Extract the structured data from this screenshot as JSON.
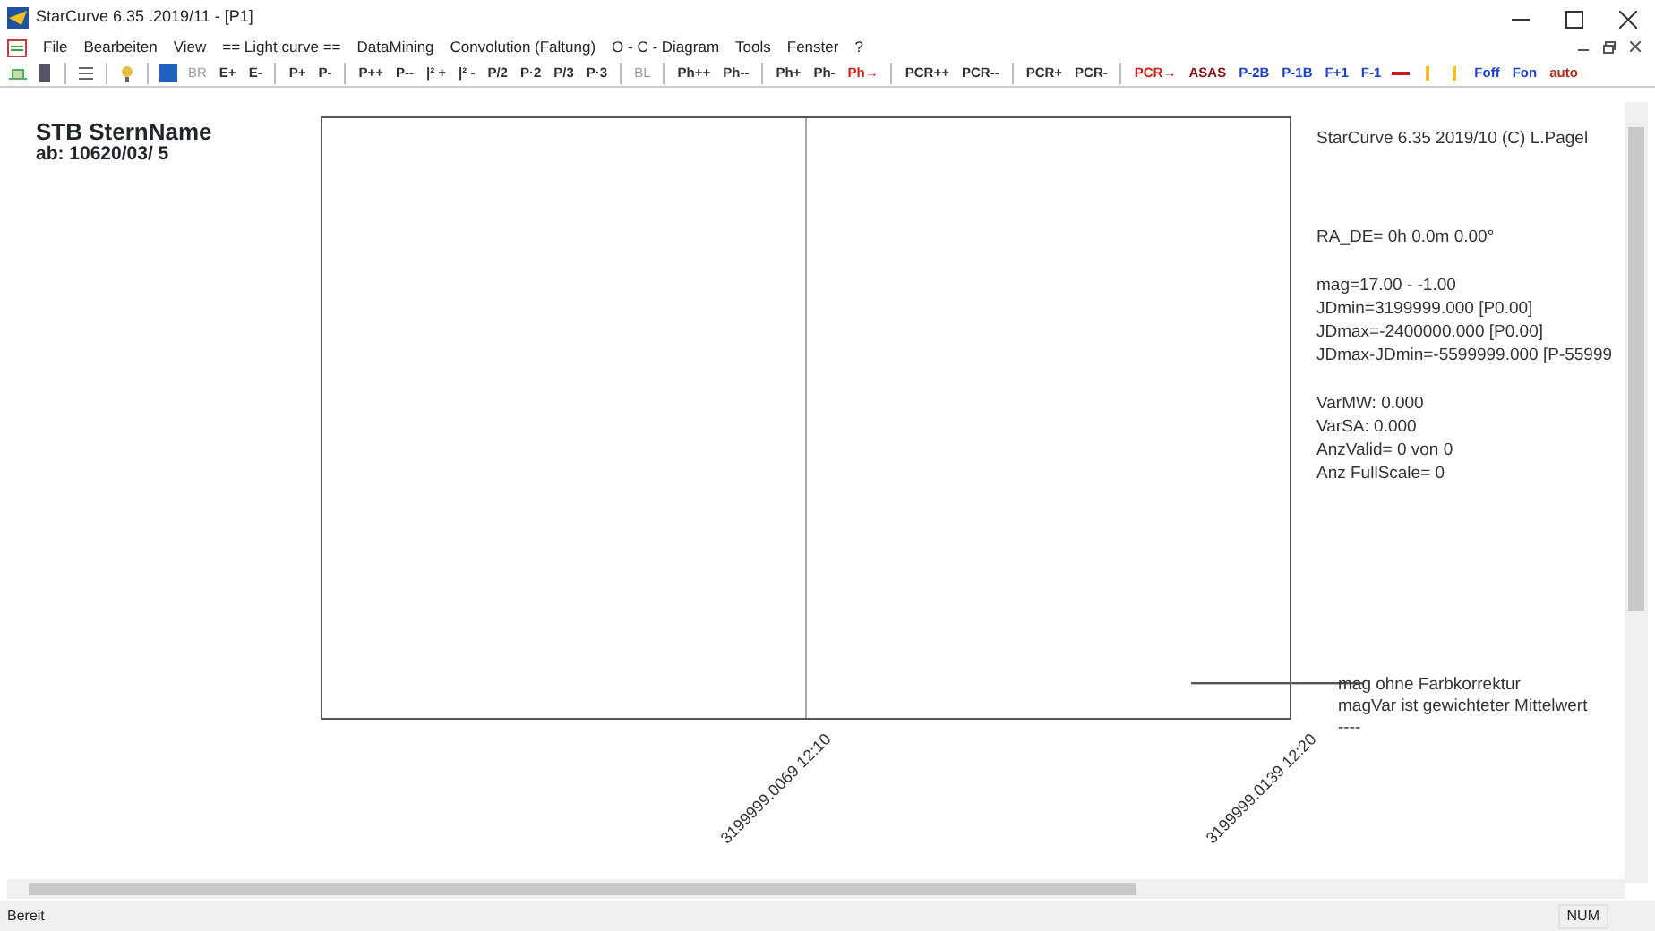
{
  "window": {
    "title": "StarCurve 6.35 .2019/11 - [P1]"
  },
  "menu": [
    "File",
    "Bearbeiten",
    "View",
    "== Light curve ==",
    "DataMining",
    "Convolution (Faltung)",
    "O - C - Diagram",
    "Tools",
    "Fenster",
    "?"
  ],
  "toolbar": [
    {
      "kind": "icon"
    },
    {
      "kind": "icon"
    },
    {
      "kind": "sep"
    },
    {
      "kind": "icon"
    },
    {
      "kind": "sep"
    },
    {
      "kind": "icon"
    },
    {
      "kind": "sep"
    },
    {
      "kind": "icon"
    },
    {
      "kind": "text",
      "label": "BR",
      "disabled": true,
      "color": "#9a9a9a"
    },
    {
      "kind": "text",
      "label": "E+",
      "disabled": false,
      "color": "#303030"
    },
    {
      "kind": "text",
      "label": "E-",
      "disabled": false,
      "color": "#303030"
    },
    {
      "kind": "sep"
    },
    {
      "kind": "text",
      "label": "P+",
      "disabled": false,
      "color": "#303030"
    },
    {
      "kind": "text",
      "label": "P-",
      "disabled": false,
      "color": "#303030"
    },
    {
      "kind": "sep"
    },
    {
      "kind": "text",
      "label": "P++",
      "disabled": false,
      "color": "#303030"
    },
    {
      "kind": "text",
      "label": "P--",
      "disabled": false,
      "color": "#303030"
    },
    {
      "kind": "text",
      "label": "|² +",
      "disabled": false,
      "color": "#303030"
    },
    {
      "kind": "text",
      "label": "|² -",
      "disabled": false,
      "color": "#303030"
    },
    {
      "kind": "text",
      "label": "P/2",
      "disabled": false,
      "color": "#303030"
    },
    {
      "kind": "text",
      "label": "P·2",
      "disabled": false,
      "color": "#303030"
    },
    {
      "kind": "text",
      "label": "P/3",
      "disabled": false,
      "color": "#303030"
    },
    {
      "kind": "text",
      "label": "P·3",
      "disabled": false,
      "color": "#303030"
    },
    {
      "kind": "sep"
    },
    {
      "kind": "text",
      "label": "BL",
      "disabled": true,
      "color": "#9a9a9a"
    },
    {
      "kind": "sep"
    },
    {
      "kind": "text",
      "label": "Ph++",
      "disabled": false,
      "color": "#303030"
    },
    {
      "kind": "text",
      "label": "Ph--",
      "disabled": false,
      "color": "#303030"
    },
    {
      "kind": "sep"
    },
    {
      "kind": "text",
      "label": "Ph+",
      "disabled": false,
      "color": "#303030"
    },
    {
      "kind": "text",
      "label": "Ph-",
      "disabled": false,
      "color": "#303030"
    },
    {
      "kind": "text",
      "label": "Ph→",
      "disabled": false,
      "color": "#d02020"
    },
    {
      "kind": "sep"
    },
    {
      "kind": "text",
      "label": "PCR++",
      "disabled": false,
      "color": "#303030"
    },
    {
      "kind": "text",
      "label": "PCR--",
      "disabled": false,
      "color": "#303030"
    },
    {
      "kind": "sep"
    },
    {
      "kind": "text",
      "label": "PCR+",
      "disabled": false,
      "color": "#303030"
    },
    {
      "kind": "text",
      "label": "PCR-",
      "disabled": false,
      "color": "#303030"
    },
    {
      "kind": "sep"
    },
    {
      "kind": "text",
      "label": "PCR→",
      "disabled": false,
      "color": "#d02020"
    },
    {
      "kind": "text",
      "label": "ASAS",
      "disabled": false,
      "color": "#8a1010"
    },
    {
      "kind": "text",
      "label": "P-2B",
      "disabled": false,
      "color": "#1c3fc8"
    },
    {
      "kind": "text",
      "label": "P-1B",
      "disabled": false,
      "color": "#1c3fc8"
    },
    {
      "kind": "text",
      "label": "F+1",
      "disabled": false,
      "color": "#1c3fc8"
    },
    {
      "kind": "text",
      "label": "F-1",
      "disabled": false,
      "color": "#1c3fc8"
    },
    {
      "kind": "icon"
    },
    {
      "kind": "icon"
    },
    {
      "kind": "icon"
    },
    {
      "kind": "text",
      "label": "Foff",
      "disabled": false,
      "color": "#1c3fc8"
    },
    {
      "kind": "text",
      "label": "Fon",
      "disabled": false,
      "color": "#1c3fc8"
    },
    {
      "kind": "text",
      "label": "auto",
      "disabled": false,
      "color": "#b03020"
    }
  ],
  "star": {
    "name": "STB SternName",
    "from": "ab: 10620/03/ 5"
  },
  "plot": {
    "x_labels": [
      "3199999.0069  12:10",
      "3199999.0139  12:20"
    ]
  },
  "info": [
    [
      "StarCurve 6.35 2019/10  (C) L.Pagel"
    ],
    [
      "RA_DE= 0h 0.0m  0.00°"
    ],
    [
      "mag=17.00 - -1.00",
      "JDmin=3199999.000 [P0.00]",
      "JDmax=-2400000.000 [P0.00]",
      "JDmax-JDmin=-5599999.000 [P-55999"
    ],
    [
      "VarMW: 0.000",
      "VarSA: 0.000",
      "AnzValid= 0 von 0",
      "Anz FullScale= 0"
    ]
  ],
  "legend": [
    "mag ohne Farbkorrektur",
    "magVar ist gewichteter Mittelwert",
    "----"
  ],
  "status_bar": {
    "text": "Bereit",
    "num": "NUM"
  }
}
